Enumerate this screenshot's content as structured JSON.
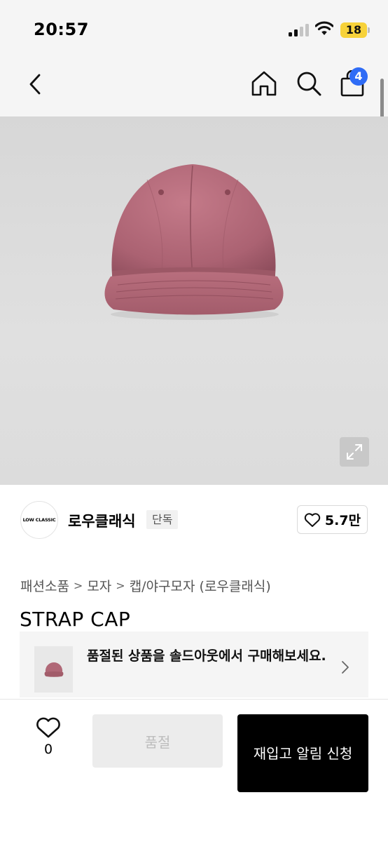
{
  "status_bar": {
    "time": "20:57",
    "battery": "18",
    "battery_color": "#f7d23a"
  },
  "nav": {
    "back_icon": "chevron-left-icon",
    "home_icon": "home-icon",
    "search_icon": "search-icon",
    "cart_icon": "shopping-bag-icon",
    "cart_count": "4",
    "badge_color": "#2f6cf6"
  },
  "hero": {
    "image": "pink-strap-cap-photo",
    "expand_icon": "expand-icon"
  },
  "brand": {
    "logo_text": "LOW CLASSIC",
    "name": "로우클래식",
    "badge": "단독",
    "like_count": "5.7만"
  },
  "breadcrumb": {
    "items": [
      "패션소품",
      "모자",
      "캡/야구모자 (로우클래식)"
    ],
    "separator": ">"
  },
  "product": {
    "title": "STRAP CAP",
    "cap_color": "#b96f7e"
  },
  "soldout_banner": {
    "text": "품절된 상품을 솔드아웃에서 구매해보세요."
  },
  "bottom_bar": {
    "wish_count": "0",
    "soldout_label": "품절",
    "restock_label": "재입고 알림 신청"
  }
}
